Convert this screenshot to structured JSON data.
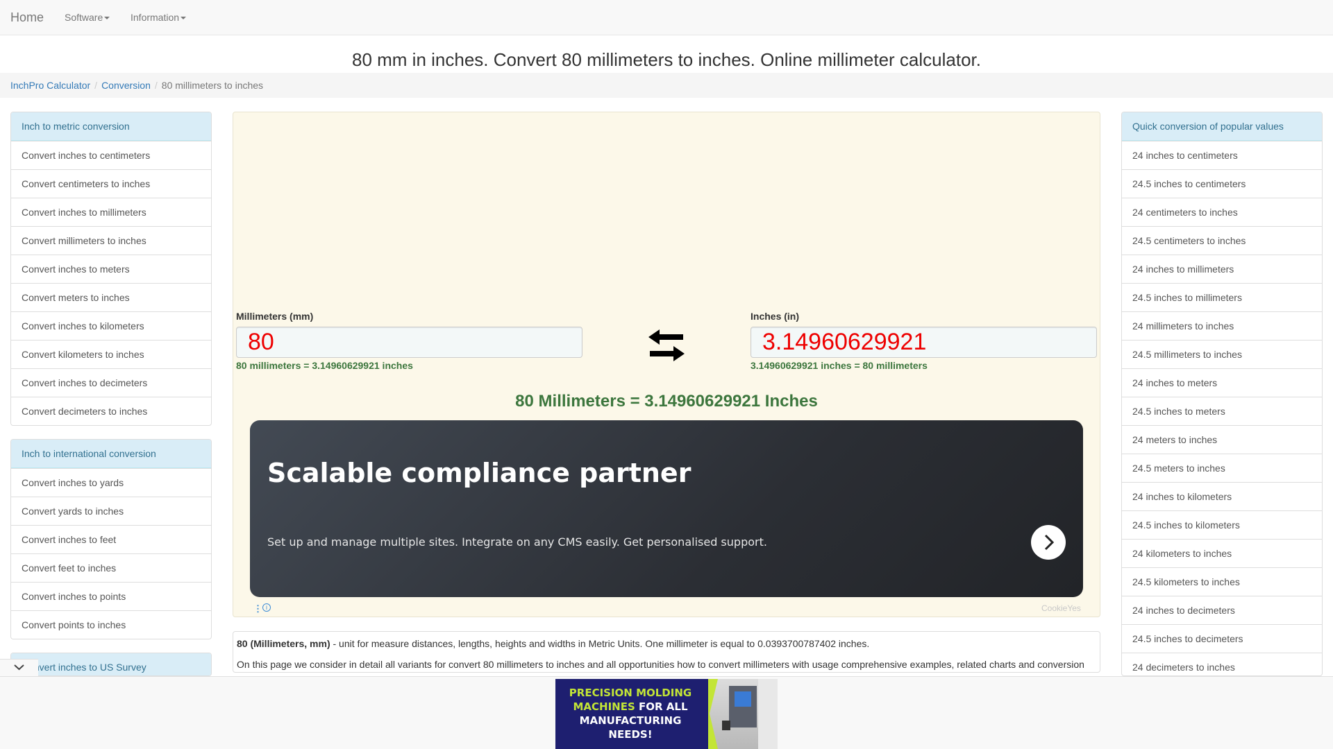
{
  "nav": {
    "brand": "Home",
    "menus": [
      "Software",
      "Information"
    ]
  },
  "page_title": "80 mm in inches. Convert 80 millimeters to inches. Online millimeter calculator.",
  "breadcrumb": {
    "items": [
      "InchPro Calculator",
      "Conversion"
    ],
    "current": "80 millimeters to inches"
  },
  "sidebar_left": {
    "groups": [
      {
        "heading": "Inch to metric conversion",
        "items": [
          "Convert inches to centimeters",
          "Convert centimeters to inches",
          "Convert inches to millimeters",
          "Convert millimeters to inches",
          "Convert inches to meters",
          "Convert meters to inches",
          "Convert inches to kilometers",
          "Convert kilometers to inches",
          "Convert inches to decimeters",
          "Convert decimeters to inches"
        ]
      },
      {
        "heading": "Inch to international conversion",
        "items": [
          "Convert inches to yards",
          "Convert yards to inches",
          "Convert inches to feet",
          "Convert feet to inches",
          "Convert inches to points",
          "Convert points to inches"
        ]
      },
      {
        "heading": "Convert inches to US Survey",
        "items": []
      }
    ]
  },
  "sidebar_right": {
    "heading": "Quick conversion of popular values",
    "items": [
      "24 inches to centimeters",
      "24.5 inches to centimeters",
      "24 centimeters to inches",
      "24.5 centimeters to inches",
      "24 inches to millimeters",
      "24.5 inches to millimeters",
      "24 millimeters to inches",
      "24.5 millimeters to inches",
      "24 inches to meters",
      "24.5 inches to meters",
      "24 meters to inches",
      "24.5 meters to inches",
      "24 inches to kilometers",
      "24.5 inches to kilometers",
      "24 kilometers to inches",
      "24.5 kilometers to inches",
      "24 inches to decimeters",
      "24.5 inches to decimeters",
      "24 decimeters to inches"
    ]
  },
  "calculator": {
    "left_label": "Millimeters (mm)",
    "left_value": "80",
    "left_help": "80 millimeters = 3.14960629921 inches",
    "right_label": "Inches (in)",
    "right_value": "3.14960629921",
    "right_help": "3.14960629921 inches = 80 millimeters",
    "result": "80 Millimeters = 3.14960629921 Inches"
  },
  "ad": {
    "title": "Scalable compliance partner",
    "text": "Set up and manage multiple sites. Integrate on any CMS easily. Get personalised support.",
    "brand": "CookieYes",
    "info_glyph": "i",
    "dots_glyph": "⋮"
  },
  "description": {
    "term": "80 (Millimeters, mm)",
    "definition": " - unit for measure distances, lengths, heights and widths in Metric Units. One millimeter is equal to 0.0393700787402 inches.",
    "paragraph": "On this page we consider in detail all variants for convert 80 millimeters to inches and all opportunities how to convert millimeters with usage comprehensive examples, related charts and conversion tables for millimeters. Here you will find all the ways for calculating and converting millimeters in inches and back. If you want to know how many inches are in 80 millimeters you can obtain the answer"
  },
  "bottom_ad": {
    "line1_a": "PRECISION MOLDING",
    "line2_a": "MACHINES",
    "line2_b": " FOR ALL",
    "line3": "MANUFACTURING",
    "line4": "NEEDS!"
  },
  "colors": {
    "accent_link": "#337ab7",
    "panel_heading_bg": "#d9edf7",
    "value_red": "#ee0000",
    "success_green": "#3c763d"
  }
}
